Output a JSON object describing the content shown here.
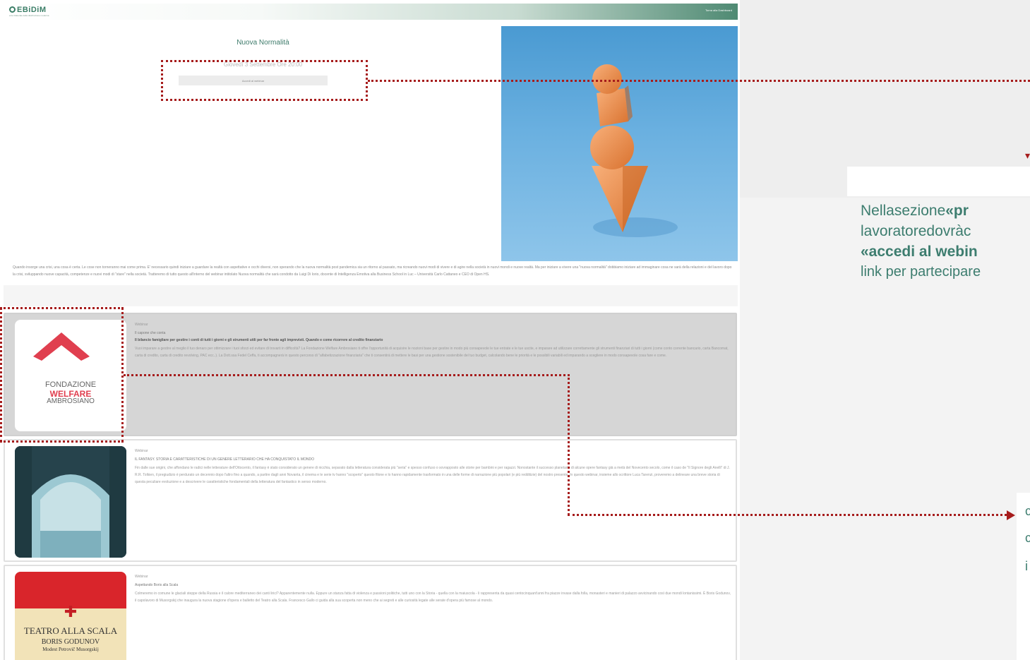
{
  "brand": {
    "logo_text": "EBiDiM",
    "logo_subtitle": "ente bilaterale della distribuzione moderna",
    "back_link": "Torna alla Dashboard"
  },
  "hero": {
    "title": "Nuova Normalità",
    "date": "Giovedì 3 Settembre Ore 20:00",
    "button_label": "Accedi al webinar",
    "description": "Quando insorge una crisi, una cosa è certa. Le cose non torneranno mai come prima. E' necessario quindi iniziare a guardare la realtà con aspettative e occhi diversi, non sperando che la nuova normalità post pandemica sia un ritorno al passato, ma ricreando nuovi modi di vivere e di agire nella società in nuovi mondi e nuove realtà. Ma per iniziare a vivere una \"nuova normalità\" dobbiamo iniziare ad immaginare cosa ne sarà della relazioni e del lavoro dopo la crisi, sviluppando nuove capacità, competenze e nuovi modi di \"stare\" nella società. Tratteremo di tutto questo all'interno del webinar intitolato Nuova normalità che sarà condotto da Luigi Di Iorio, docente di Intelligenza Emotiva alla Business School in Luc – Università Carlo Cattaneo e CEO di Open HS."
  },
  "cards": [
    {
      "logo_top": "FONDAZIONE",
      "logo_mid": "WELFARE",
      "logo_bot": "AMBROSIANO",
      "category": "Webinar",
      "subtitle": "Il capone che conta",
      "title": "Il bilancio famigliare per gestire i conti di tutti i giorni e gli strumenti utili per far fronte agli imprevisti. Quando e come ricorrere al credito finanziario",
      "body": "Vuoi imparare a gestire al meglio il tuo denaro per ottimizzare i tuoi sforzi ed evitare di trovarti in difficoltà? La Fondazione Welfare Ambrosiano ti offre l'opportunità di acquisire le nozioni base per gestire in modo più consapevole le tue entrate e le tue uscite, e imparare ad utilizzare correttamente gli strumenti finanziari di tutti i giorni (come conto corrente bancario, carta Bancomat, carta di credito, carta di credito revolving, PAC ecc..). La Dott.ssa Fedel Ceffa, ti accompagnerà in questo percorso di \"alfabetizzazione finanziaria\" che ti consentirà di mettere le basi per una gestione sostenibile del tuo budget, calcolando bene le priorità e le possibili variabili ed imparando a scegliere in modo consapevole cosa fare e come."
    },
    {
      "category": "Webinar",
      "title": "IL FANTASY. STORIA E CARATTERISTICHE DI UN GENERE LETTERARIO CHE HA CONQUISTATO IL MONDO",
      "body": "Fin dalle sue origini, che affondano le radici nelle letterature dell'Ottocento, il fantasy è stato considerato un genere di nicchia, separato dalla letteratura considerata più \"seria\" e spesso confuso o sovrapposto alle storie per bambini e per ragazzi. Nonostante il successo planetario di alcune opere fantasy già a metà del Novecento secolo, come il caso de \"Il Signore degli Anelli\" di J. R.R. Tolkien, il pregiudizio è perdurato un decennio dopo l'altro fino a quando, a partire dagli anni Novanta, il cinema e le serie tv hanno \"scoperto\" questo filone e lo hanno rapidamente trasformato in una delle forme di narrazione più popolari (e più redditizie) del nostro presente. In questo webinar, insieme allo scrittore Luca Tarenzi, proveremo a delineare una breve storia di questa peculiare evoluzione e a descrivere le caratteristiche fondamentali della letteratura del fantastico in senso moderno."
    },
    {
      "logo_top": "TEATRO ALLA SCALA",
      "logo_mid": "BORIS GODUNOV",
      "logo_bot": "Modest Petrovič Musorgskij",
      "category": "Webinar",
      "title": "Aspettando Boris alla Scala",
      "body": "Colmeremo in comune le glaciali steppe della Russia e il calore mediterraneo dei canti lirici? Apparentemente nulla. Eppure un stanza fatta di violenza e passioni politiche, tutti uno con la Storia - quella con la maiuscola - li rappresenta da quasi centocinquant'anni fra piazze invase dalla folla, monasteri e manieri di palazzo avvicinando così due mondi lontanissimi. È Boris Godunov, il capolavoro di Musorgskij che inaugura la nuova stagione d'opera e balletto del Teatro alla Scala. Francesco Gallo ci guida alla sua scoperta non meno che ai segreti e alle curiosità legate alle serate d'opera più famose al mondo."
    }
  ],
  "callout": {
    "line1_a": "Nella",
    "line1_b": "sezione",
    "line1_c": "«pr",
    "line2_a": "lavoratore",
    "line2_b": "dovrà",
    "line2_c": "c",
    "line3": "«accedi al webin",
    "line4": "link per partecipare"
  },
  "callout2_glyphs": [
    "c",
    "c",
    "i"
  ],
  "colors": {
    "accent": "#3d7d6f",
    "highlight": "#a61c1c",
    "brand_red": "#e03f4f"
  }
}
